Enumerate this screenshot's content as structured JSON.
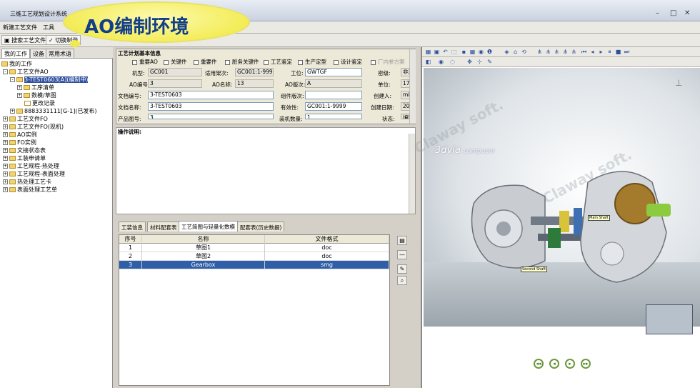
{
  "window": {
    "title": "三维工艺规划设计系统"
  },
  "overlay": {
    "text": "AO编制环境"
  },
  "menu": [
    "新建工艺文件",
    "工具"
  ],
  "toolbar": {
    "search_btn": "搜索工艺文件",
    "switch_btn": "切换制造"
  },
  "left_tabs": [
    "我的工作",
    "设备",
    "常用术语"
  ],
  "tree": [
    "我的工作",
    "工艺文件AO",
    "3-TEST0603[A](编制中)",
    "工序清单",
    "数模/草图",
    "更改记录",
    "8883331111[G-1](已发布)",
    "工艺文件FO",
    "工艺文件FO(现机)",
    "AO实例",
    "FO实例",
    "文接状态表",
    "工装申请单",
    "工艺规程-热处理",
    "工艺规程-表面处理",
    "热处理工艺卡",
    "表面处理工艺单"
  ],
  "form": {
    "section_title": "工艺计划基本信息",
    "checkboxes": [
      "重要AO",
      "关键件",
      "重要件",
      "脏务关键件",
      "工艺鉴定",
      "生产定型",
      "设计鉴定",
      "厂内参方案"
    ],
    "jixing_label": "机型:",
    "jixing_value": "GC001",
    "shiyong_label": "适用架次:",
    "shiyong_value": "GC001:1-9999",
    "gongwei_label": "工位:",
    "gongwei_value": "GWTGF",
    "miji_label": "密级:",
    "miji_value": "非涉",
    "ao_no_label": "AO编号:",
    "ao_no_value": "3",
    "ao_name_label": "AO名称:",
    "ao_name_value": "13",
    "ao_ver_label": "AO版次:",
    "ao_ver_value": "A",
    "danwei_label": "单位:",
    "danwei_value": "176",
    "doc_no_label": "文档编号:",
    "doc_no_value": "3-TEST0603",
    "zujian_label": "组件版次:",
    "zujian_value": "",
    "chuangjian_label": "创建人:",
    "chuangjian_value": "mini",
    "doc_name_label": "文档名称:",
    "doc_name_value": "3-TEST0603",
    "youxiao_label": "有效性:",
    "youxiao_value": "GC001:1-9999",
    "date_label": "创建日期:",
    "date_value": "201",
    "part_label": "产品图号:",
    "part_value": "3",
    "qty_label": "装机数量:",
    "qty_value": "1",
    "status_label": "状态:",
    "status_value": "编制"
  },
  "op_section": {
    "title": "操作说明:"
  },
  "tabs": [
    "工装信息",
    "材料配套表",
    "工艺简图与轻量化数模",
    "配套表(历史数据)"
  ],
  "grid": {
    "headers": [
      "序号",
      "名称",
      "文件格式"
    ],
    "rows": [
      {
        "no": "1",
        "name": "草图1",
        "fmt": "doc"
      },
      {
        "no": "2",
        "name": "草图2",
        "fmt": "doc"
      },
      {
        "no": "3",
        "name": "Gearbox",
        "fmt": "smg"
      }
    ]
  },
  "viewer": {
    "brand": "3dvia",
    "brand_sub": "composer",
    "callouts": [
      "Main Shaft",
      "Second Shaft"
    ],
    "watermark": "Claway soft."
  }
}
